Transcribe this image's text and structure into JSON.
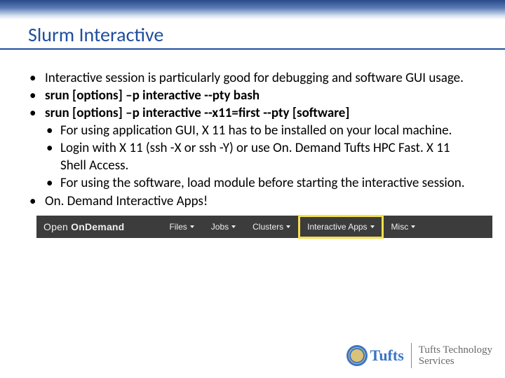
{
  "title": "Slurm Interactive",
  "bullets": [
    {
      "text": "Interactive session is particularly good for debugging and software GUI usage.",
      "bold": false
    },
    {
      "text": "srun [options] –p interactive --pty bash",
      "bold": true
    },
    {
      "text": "srun [options] –p interactive --x11=first --pty [software]",
      "bold": true,
      "sub": [
        "For using application GUI, X 11 has to be installed on your local machine.",
        "Login with X 11 (ssh -X or ssh -Y) or use On. Demand Tufts HPC Fast. X 11 Shell Access.",
        "For using the software, load module before starting the interactive session."
      ]
    },
    {
      "text": "On. Demand Interactive Apps!",
      "bold": false
    }
  ],
  "menubar": {
    "brand_light": "Open",
    "brand_bold": "OnDemand",
    "items": [
      {
        "label": "Files",
        "caret": true,
        "highlight": false
      },
      {
        "label": "Jobs",
        "caret": true,
        "highlight": false
      },
      {
        "label": "Clusters",
        "caret": true,
        "highlight": false
      },
      {
        "label": "Interactive Apps",
        "caret": true,
        "highlight": true
      },
      {
        "label": "Misc",
        "caret": true,
        "highlight": false
      }
    ]
  },
  "footer": {
    "tufts": "Tufts",
    "tts_line1": "Tufts Technology",
    "tts_line2": "Services"
  }
}
